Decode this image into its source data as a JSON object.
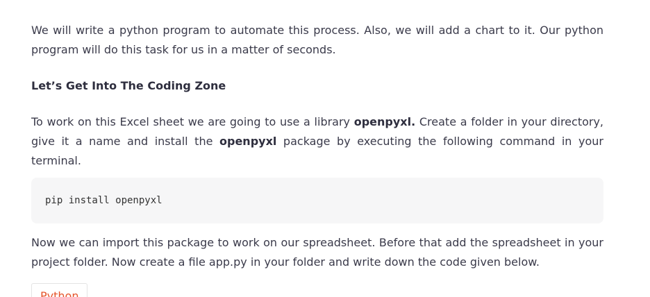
{
  "paragraphs": {
    "intro": "We will write a python program to automate this process. Also, we will add a chart to it. Our python program will do this task for us in a matter of seconds.",
    "coding_zone_heading": "Let’s Get Into The Coding Zone",
    "library_part1": "To work on this Excel sheet we are going to use a library ",
    "library_bold1": "openpyxl.",
    "library_part2": " Create a folder in your directory, give it a name and install the ",
    "library_bold2": "openpyxl",
    "library_part3": " package by executing the following command in your terminal.",
    "import_text": "Now we can import this package to work on our spreadsheet. Before that add the spreadsheet in your project folder. Now create a file app.py in your folder and write down the code given below."
  },
  "code_block": {
    "command": "pip install openpyxl"
  },
  "code_tabs": {
    "language_label": "Python",
    "accent_color": "#e5542b"
  }
}
